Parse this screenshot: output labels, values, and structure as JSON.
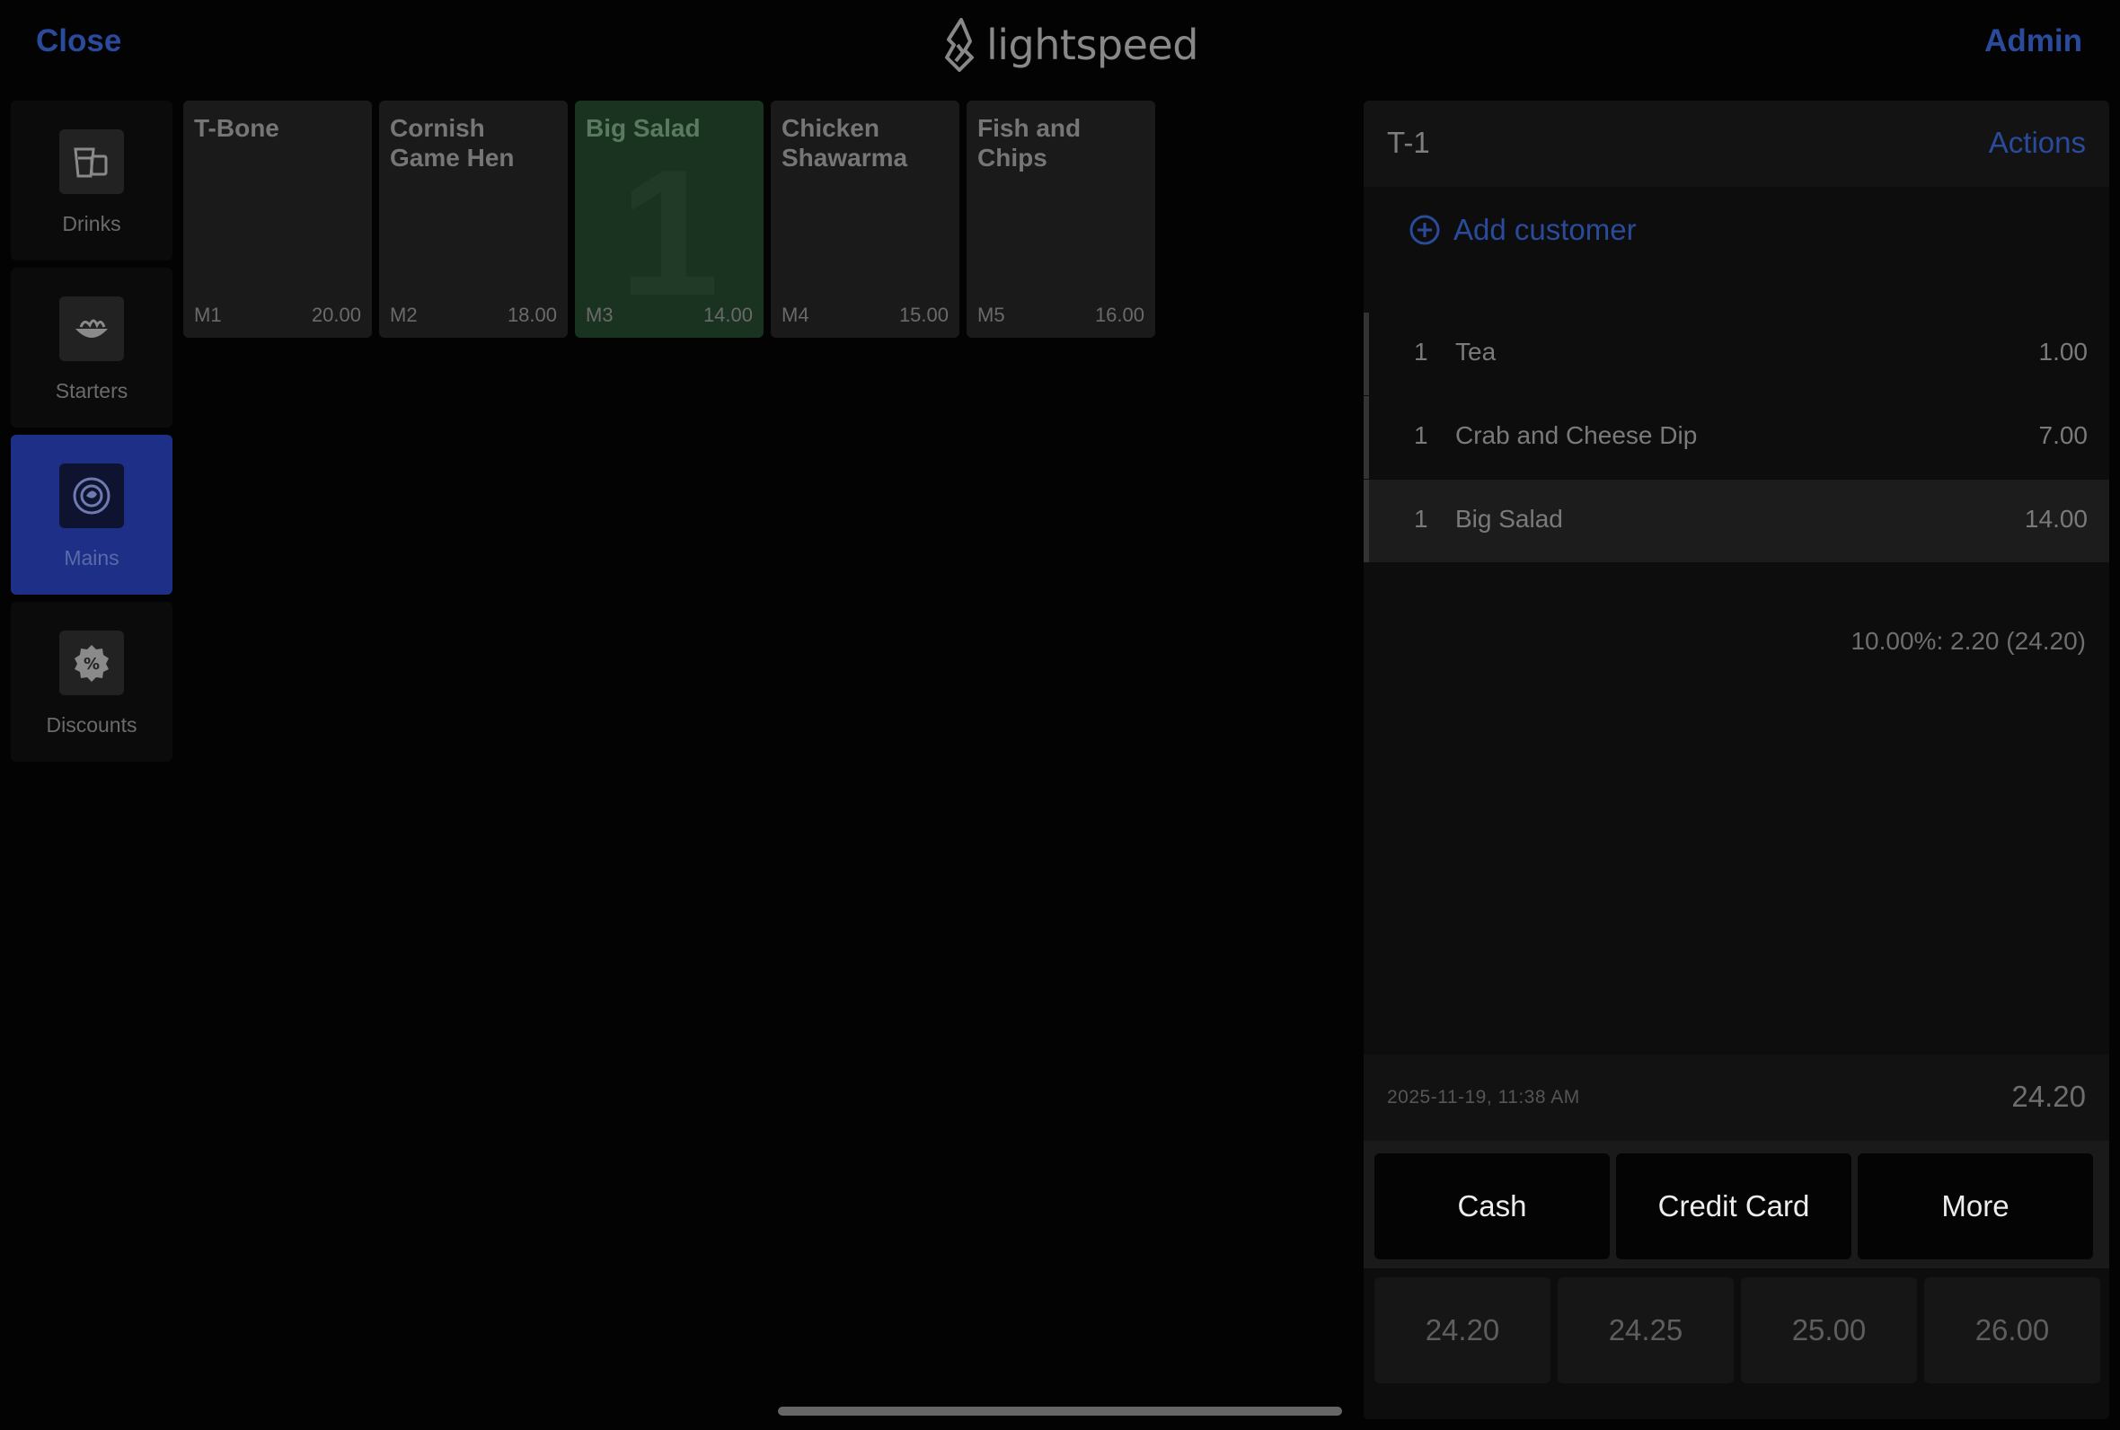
{
  "topbar": {
    "close_label": "Close",
    "logo_text": "lightspeed",
    "admin_label": "Admin"
  },
  "sidebar": {
    "items": [
      {
        "label": "Drinks",
        "icon": "drink-icon",
        "active": false
      },
      {
        "label": "Starters",
        "icon": "bowl-icon",
        "active": false
      },
      {
        "label": "Mains",
        "icon": "plate-icon",
        "active": true
      },
      {
        "label": "Discounts",
        "icon": "percent-badge-icon",
        "active": false
      }
    ]
  },
  "menu": {
    "items": [
      {
        "name": "T-Bone",
        "code": "M1",
        "price": "20.00",
        "qty": ""
      },
      {
        "name": "Cornish Game Hen",
        "code": "M2",
        "price": "18.00",
        "qty": ""
      },
      {
        "name": "Big Salad",
        "code": "M3",
        "price": "14.00",
        "qty": "1"
      },
      {
        "name": "Chicken Shawarma",
        "code": "M4",
        "price": "15.00",
        "qty": ""
      },
      {
        "name": "Fish and Chips",
        "code": "M5",
        "price": "16.00",
        "qty": ""
      }
    ]
  },
  "order": {
    "table": "T-1",
    "actions_label": "Actions",
    "add_customer_label": "Add customer",
    "lines": [
      {
        "qty": "1",
        "name": "Tea",
        "price": "1.00"
      },
      {
        "qty": "1",
        "name": "Crab and Cheese Dip",
        "price": "7.00"
      },
      {
        "qty": "1",
        "name": "Big Salad",
        "price": "14.00"
      }
    ],
    "tax_line": "10.00%: 2.20 (24.20)",
    "timestamp": "2025-11-19, 11:38 AM",
    "total": "24.20"
  },
  "payment": {
    "methods": [
      "Cash",
      "Credit Card",
      "More"
    ],
    "quick_amounts": [
      "24.20",
      "24.25",
      "25.00",
      "26.00"
    ]
  },
  "colors": {
    "accent": "#2a4a9c",
    "active_category": "#1d2f86",
    "selected_tile": "#1a3220"
  }
}
